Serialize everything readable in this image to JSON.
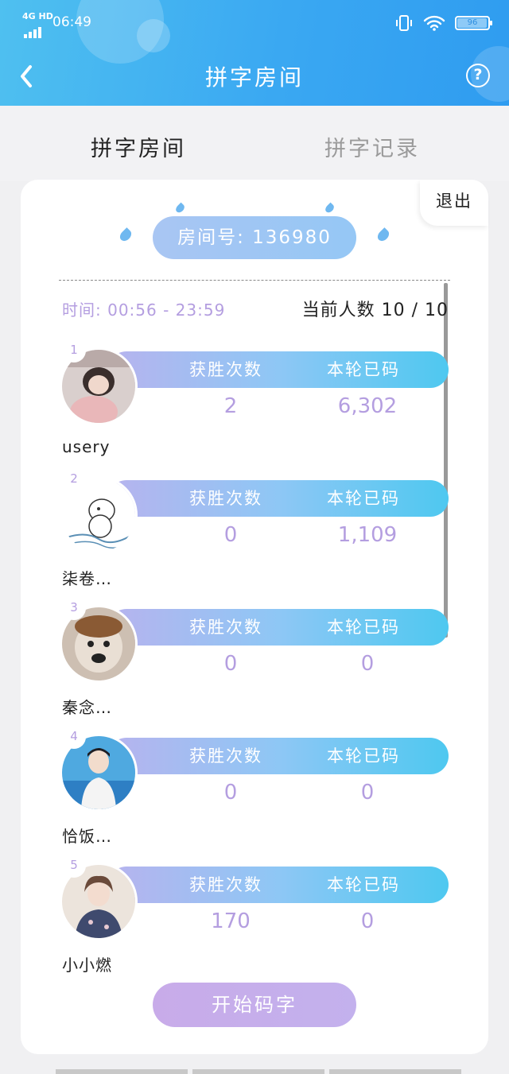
{
  "status_bar": {
    "network": "4G HD",
    "time": "06:49",
    "battery": "96"
  },
  "header": {
    "title": "拼字房间"
  },
  "tabs": [
    {
      "label": "拼字房间"
    },
    {
      "label": "拼字记录"
    }
  ],
  "room": {
    "exit_label": "退出",
    "room_number_text": "房间号: 136980",
    "time_text": "时间: 00:56 - 23:59",
    "count_text": "当前人数 10 / 10",
    "win_label": "获胜次数",
    "typed_label": "本轮已码",
    "players": [
      {
        "rank": "1",
        "name": "usery",
        "wins": "2",
        "typed": "6,302"
      },
      {
        "rank": "2",
        "name": "柒卷…",
        "wins": "0",
        "typed": "1,109"
      },
      {
        "rank": "3",
        "name": "秦念…",
        "wins": "0",
        "typed": "0"
      },
      {
        "rank": "4",
        "name": "恰饭…",
        "wins": "0",
        "typed": "0"
      },
      {
        "rank": "5",
        "name": "小小燃",
        "wins": "170",
        "typed": "0"
      }
    ],
    "start_label": "开始码字"
  },
  "colors": {
    "header_blue": "#3aa8f2",
    "accent_purple": "#b49ee0",
    "bar_cyan": "#4ec8f0"
  }
}
